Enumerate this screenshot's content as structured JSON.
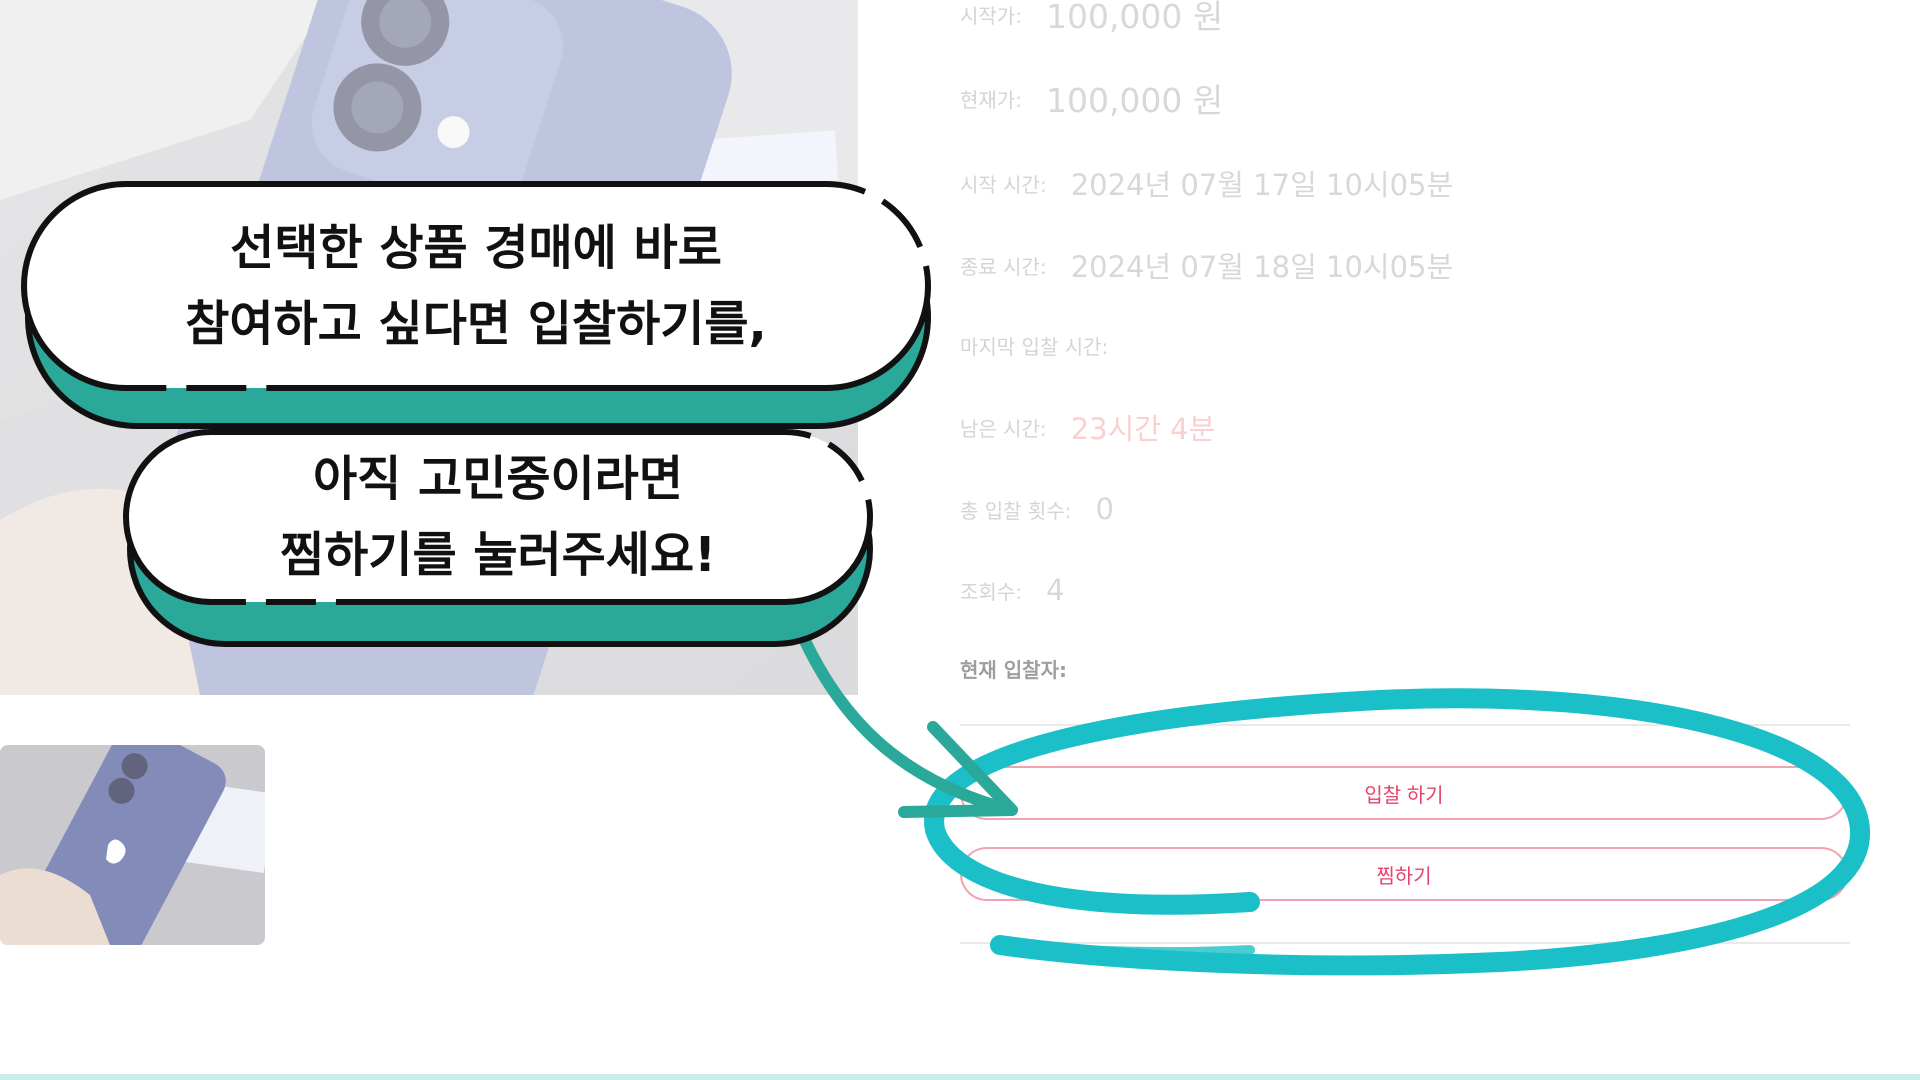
{
  "info_rows": {
    "start_price": {
      "label": "시작가:",
      "value": "100,000 원"
    },
    "current_price": {
      "label": "현재가:",
      "value": "100,000 원"
    },
    "start_time": {
      "label": "시작 시간:",
      "value": "2024년 07월 17일 10시05분"
    },
    "end_time": {
      "label": "종료 시간:",
      "value": "2024년 07월 18일 10시05분"
    },
    "last_bid_time": {
      "label": "마지막 입찰 시간:",
      "value": ""
    },
    "remaining_time": {
      "label": "남은 시간:",
      "value": "23시간 4분"
    },
    "total_bids": {
      "label": "총 입찰 횟수:",
      "value": "0"
    },
    "views": {
      "label": "조회수:",
      "value": "4"
    },
    "current_bidder": {
      "label": "현재 입찰자:",
      "value": ""
    }
  },
  "buttons": {
    "bid": "입찰 하기",
    "wishlist": "찜하기"
  },
  "callouts": {
    "bubble1_line1": "선택한 상품 경매에 바로",
    "bubble1_line2": "참여하고 싶다면 입찰하기를,",
    "bubble2_line1": "아직 고민중이라면",
    "bubble2_line2": "찜하기를 눌러주세요!"
  },
  "colors": {
    "accent_pink": "#e8426b",
    "highlight_teal": "#1bbfc7",
    "bubble_shadow": "#2aa89a"
  },
  "icons": {
    "arrow": "curved-arrow-icon",
    "circle": "hand-drawn-circle-icon",
    "product": "phone-product-image",
    "logo": "apple-logo-icon"
  }
}
